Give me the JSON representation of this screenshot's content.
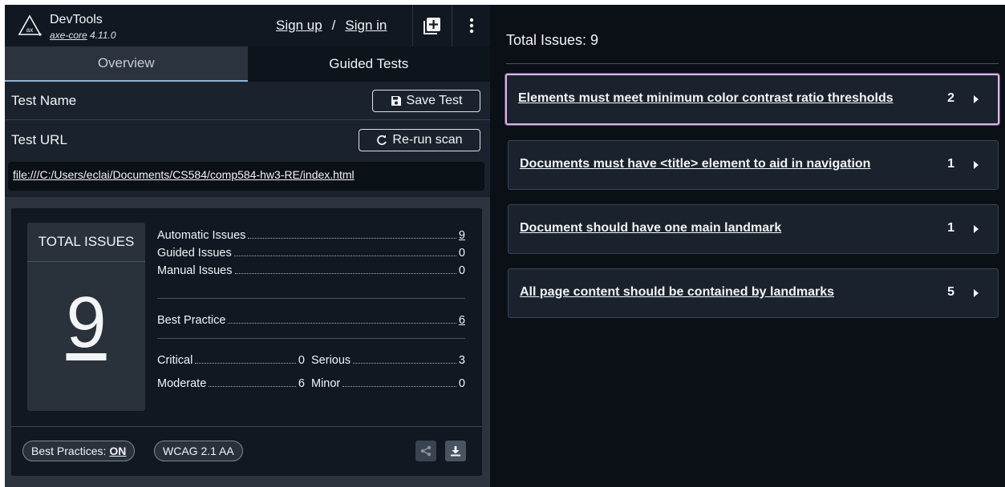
{
  "header": {
    "app_name": "DevTools",
    "engine_name": "axe-core",
    "engine_version": "4.11.0",
    "logo_text": "ax",
    "signup": "Sign up",
    "separator": "/",
    "signin": "Sign in"
  },
  "tabs": [
    {
      "label": "Overview",
      "active": true
    },
    {
      "label": "Guided Tests",
      "active": false
    }
  ],
  "test_name": {
    "label": "Test Name",
    "button": "Save Test"
  },
  "test_url": {
    "label": "Test URL",
    "button": "Re-run scan",
    "value": "file:///C:/Users/eclai/Documents/CS584/comp584-hw3-RE/index.html"
  },
  "summary": {
    "total_label": "TOTAL ISSUES",
    "total": "9",
    "automatic": {
      "label": "Automatic Issues",
      "value": "9"
    },
    "guided": {
      "label": "Guided Issues",
      "value": "0"
    },
    "manual": {
      "label": "Manual Issues",
      "value": "0"
    },
    "best_practice": {
      "label": "Best Practice",
      "value": "6"
    },
    "critical": {
      "label": "Critical",
      "value": "0"
    },
    "serious": {
      "label": "Serious",
      "value": "3"
    },
    "moderate": {
      "label": "Moderate",
      "value": "6"
    },
    "minor": {
      "label": "Minor",
      "value": "0"
    }
  },
  "footer": {
    "best_practices_label": "Best Practices:",
    "best_practices_state": "ON",
    "standard": "WCAG 2.1 AA"
  },
  "results": {
    "title": "Total Issues: 9",
    "issues": [
      {
        "title": "Elements must meet minimum color contrast ratio thresholds",
        "count": "2"
      },
      {
        "title": "Documents must have <title> element to aid in navigation",
        "count": "1"
      },
      {
        "title": "Document should have one main landmark",
        "count": "1"
      },
      {
        "title": "All page content should be contained by landmarks",
        "count": "5"
      }
    ]
  },
  "colors": {
    "background": "#0b1017",
    "panel": "#1a222d",
    "active_tab_indicator": "#8ab6d9",
    "selected_issue_border": "#d8b4e8"
  }
}
